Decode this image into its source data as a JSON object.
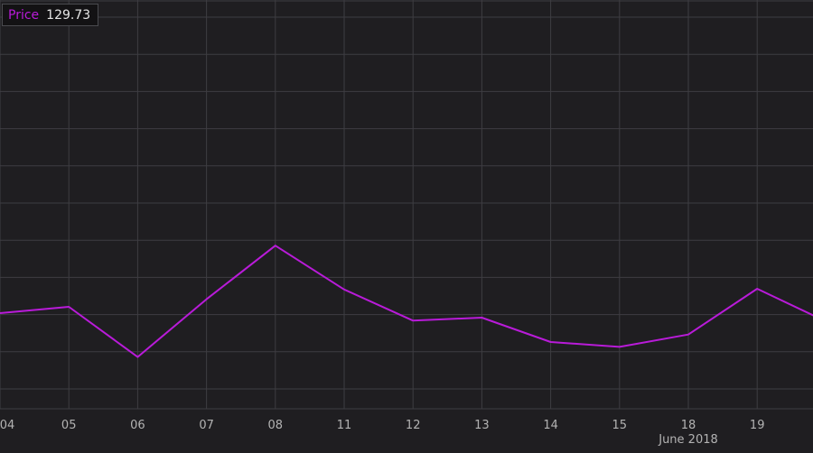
{
  "legend": {
    "name": "Price",
    "value": "129.73"
  },
  "colors": {
    "background": "#1f1e21",
    "grid": "#3e3d42",
    "line": "#b91bd9",
    "text": "#b3b3b3"
  },
  "chart_data": {
    "type": "line",
    "categories": [
      "04",
      "05",
      "06",
      "07",
      "08",
      "11",
      "12",
      "13",
      "14",
      "15",
      "18",
      "19"
    ],
    "month_label": "June 2018",
    "series": [
      {
        "name": "Price",
        "values": [
          129.95,
          130.12,
          128.78,
          130.32,
          131.75,
          130.58,
          129.75,
          129.83,
          129.18,
          129.05,
          129.38,
          130.6,
          129.73
        ]
      }
    ],
    "ylim": [
      127.4,
      138.3
    ],
    "grid": true,
    "legend_position": "top-left"
  }
}
